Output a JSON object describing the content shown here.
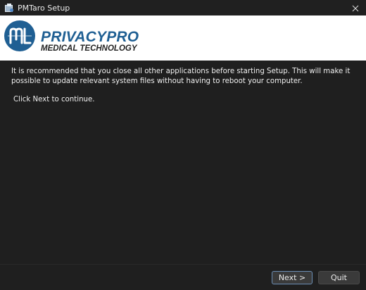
{
  "window": {
    "title": "PMTaro Setup"
  },
  "banner": {
    "brand_line1": "PRIVACYPRO",
    "brand_line2": "MEDICAL TECHNOLOGY",
    "brand_color": "#1f5f93"
  },
  "body": {
    "intro": "It is recommended that you close all other applications before starting Setup. This will make it possible to update relevant system files without having to reboot your computer.",
    "continue_hint": "Click Next to continue."
  },
  "buttons": {
    "next_label": "Next >",
    "quit_label": "Quit"
  },
  "icons": {
    "app": "installer-icon",
    "close": "close-icon",
    "logo": "privacypro-logo-icon"
  }
}
